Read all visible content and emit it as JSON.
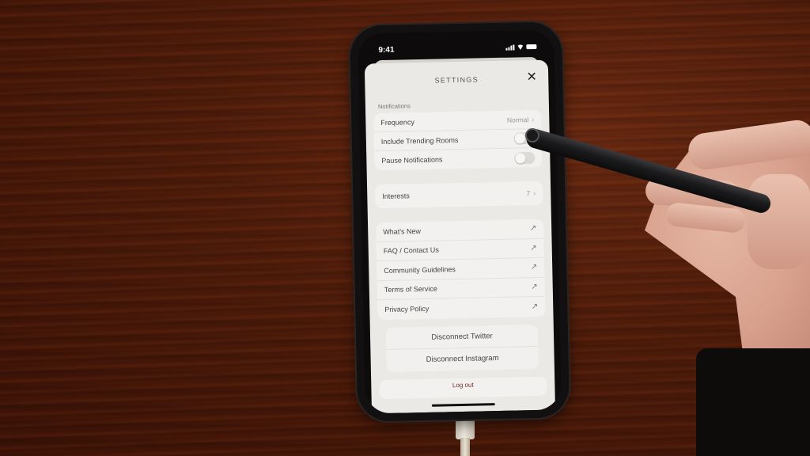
{
  "status_bar": {
    "time": "9:41",
    "icons": [
      "cellular-signal-icon",
      "wifi-icon",
      "battery-icon"
    ]
  },
  "settings": {
    "title": "SETTINGS",
    "close_icon": "close-icon",
    "notifications": {
      "section_label": "Notifications",
      "frequency": {
        "label": "Frequency",
        "value": "Normal"
      },
      "include_trending_rooms": {
        "label": "Include Trending Rooms",
        "on": false
      },
      "pause_notifications": {
        "label": "Pause Notifications",
        "on": false
      }
    },
    "interests": {
      "label": "Interests",
      "value": "7"
    },
    "links": [
      {
        "label": "What's New",
        "icon": "external-link-arrow-icon"
      },
      {
        "label": "FAQ / Contact Us",
        "icon": "external-link-arrow-icon"
      },
      {
        "label": "Community Guidelines",
        "icon": "external-link-arrow-icon"
      },
      {
        "label": "Terms of Service",
        "icon": "external-link-arrow-icon"
      },
      {
        "label": "Privacy Policy",
        "icon": "external-link-arrow-icon"
      }
    ],
    "connections": {
      "disconnect_twitter": "Disconnect Twitter",
      "disconnect_instagram": "Disconnect Instagram"
    },
    "logout": "Log out"
  },
  "glyphs": {
    "close": "✕",
    "chevron": "›",
    "arrow": "↗"
  },
  "colors": {
    "sheet_background": "#ebe9e6",
    "group_background": "#f2f1ef",
    "logout_text": "#7a2a2a"
  }
}
